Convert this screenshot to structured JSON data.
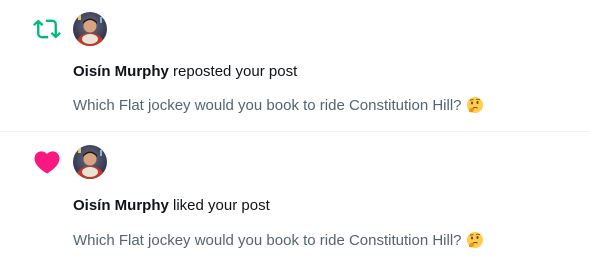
{
  "notifications": [
    {
      "type_icon": "repost-icon",
      "icon_color": "#00ba7c",
      "actor": "Oisín Murphy",
      "action": "reposted your post",
      "post_text": "Which Flat jockey would you book to ride Constitution Hill?",
      "emoji": "thinking-face-icon"
    },
    {
      "type_icon": "heart-icon",
      "icon_color": "#f91880",
      "actor": "Oisín Murphy",
      "action": "liked your post",
      "post_text": "Which Flat jockey would you book to ride Constitution Hill?",
      "emoji": "thinking-face-icon"
    }
  ]
}
